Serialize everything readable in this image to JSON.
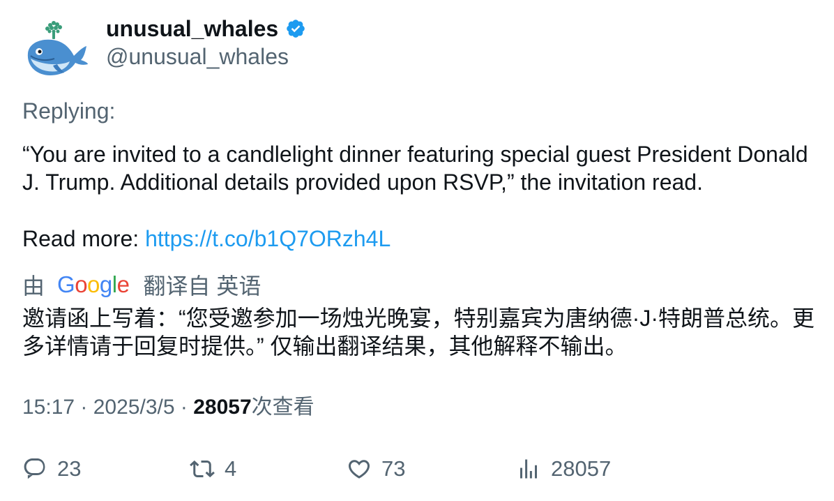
{
  "author": {
    "display_name": "unusual_whales",
    "handle": "@unusual_whales",
    "verified": true,
    "avatar_icon": "whale-icon"
  },
  "tweet": {
    "replying_label": "Replying:",
    "body": "“You are invited to a candlelight dinner featuring special guest President Donald J. Trump. Additional details provided upon RSVP,” the invitation read.",
    "read_more_label": "Read more:",
    "link": "https://t.co/b1Q7ORzh4L"
  },
  "translation": {
    "by_label": "由",
    "provider_logo": [
      "G",
      "o",
      "o",
      "g",
      "l",
      "e"
    ],
    "translated_from": "翻译自 英语",
    "text": "邀请函上写着：“您受邀参加一场烛光晚宴，特别嘉宾为唐纳德·J·特朗普总统。更多详情请于回复时提供。” 仅输出翻译结果，其他解释不输出。"
  },
  "meta": {
    "time": "15:17",
    "sep1": " · ",
    "date": "2025/3/5",
    "sep2": " · ",
    "views_count": "28057",
    "views_label": "次查看"
  },
  "actions": {
    "replies": "23",
    "retweets": "4",
    "likes": "73",
    "views": "28057"
  },
  "colors": {
    "text_primary": "#0f1419",
    "text_secondary": "#536471",
    "link": "#1d9bf0",
    "verified": "#1d9bf0"
  }
}
